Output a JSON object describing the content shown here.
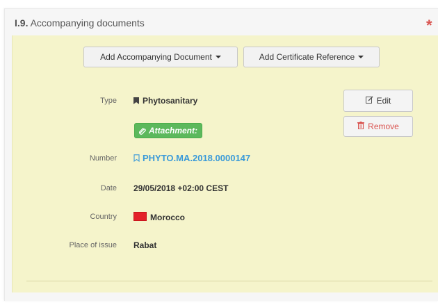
{
  "section": {
    "number": "I.9.",
    "title": "Accompanying documents",
    "required_mark": "*"
  },
  "toolbar": {
    "add_document_label": "Add Accompanying Document",
    "add_certificate_label": "Add Certificate Reference"
  },
  "actions": {
    "edit_label": "Edit",
    "remove_label": "Remove"
  },
  "document": {
    "type_label": "Type",
    "type_value": "Phytosanitary",
    "attachment_label": "Attachment:",
    "number_label": "Number",
    "number_value": "PHYTO.MA.2018.0000147",
    "date_label": "Date",
    "date_value": "29/05/2018 +02:00 CEST",
    "country_label": "Country",
    "country_value": "Morocco",
    "place_label": "Place of issue",
    "place_value": "Rabat"
  },
  "colors": {
    "box_background": "#f5f4cb",
    "link": "#3a9ad9",
    "danger": "#d9534f",
    "success": "#5cb85c"
  },
  "icons": {
    "type": "bookmark-icon",
    "number": "bookmark-outline-icon",
    "country": "morocco-flag-icon",
    "edit": "edit-icon",
    "remove": "trash-icon",
    "attachment": "paperclip-icon"
  }
}
